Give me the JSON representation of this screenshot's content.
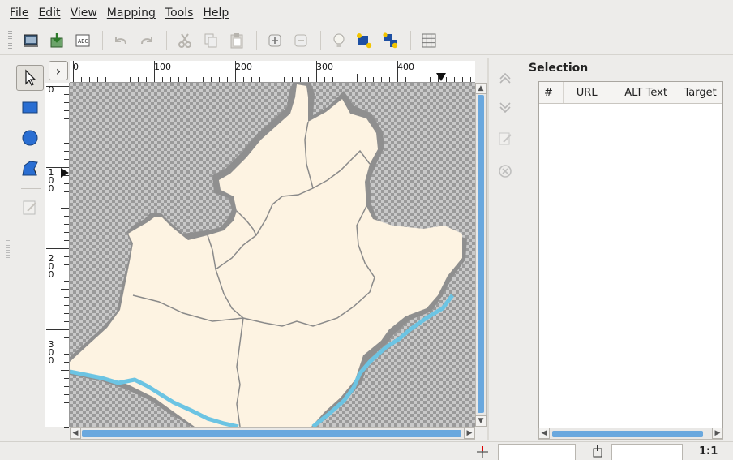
{
  "menu": {
    "items": [
      "File",
      "Edit",
      "View",
      "Mapping",
      "Tools",
      "Help"
    ]
  },
  "toolbar": {
    "icons": [
      "open-project-icon",
      "save-icon",
      "image-icon",
      "undo-icon",
      "redo-icon",
      "cut-icon",
      "copy-icon",
      "paste-icon",
      "zoom-in-icon",
      "zoom-out-icon",
      "tip-icon",
      "bring-to-front-icon",
      "send-to-back-icon",
      "grid-icon"
    ]
  },
  "tools": {
    "items": [
      "select-tool",
      "rectangle-tool",
      "circle-tool",
      "polygon-tool",
      "edit-tool"
    ]
  },
  "rulers": {
    "horizontal_labels": [
      "0",
      "100",
      "200",
      "300",
      "400"
    ],
    "vertical_labels": [
      "0",
      "1\n0\n0",
      "2\n0\n0",
      "3\n0\n0"
    ]
  },
  "selection": {
    "title": "Selection",
    "columns": [
      "#",
      "URL",
      "ALT Text",
      "Target"
    ]
  },
  "status": {
    "zoom": "1:1",
    "x_value": "",
    "y_value": ""
  },
  "colors": {
    "map_fill": "#fdf3e2",
    "map_border": "#8f8f8f",
    "coast": "#6cc4e3",
    "scroll_thumb": "#6aa8de"
  }
}
